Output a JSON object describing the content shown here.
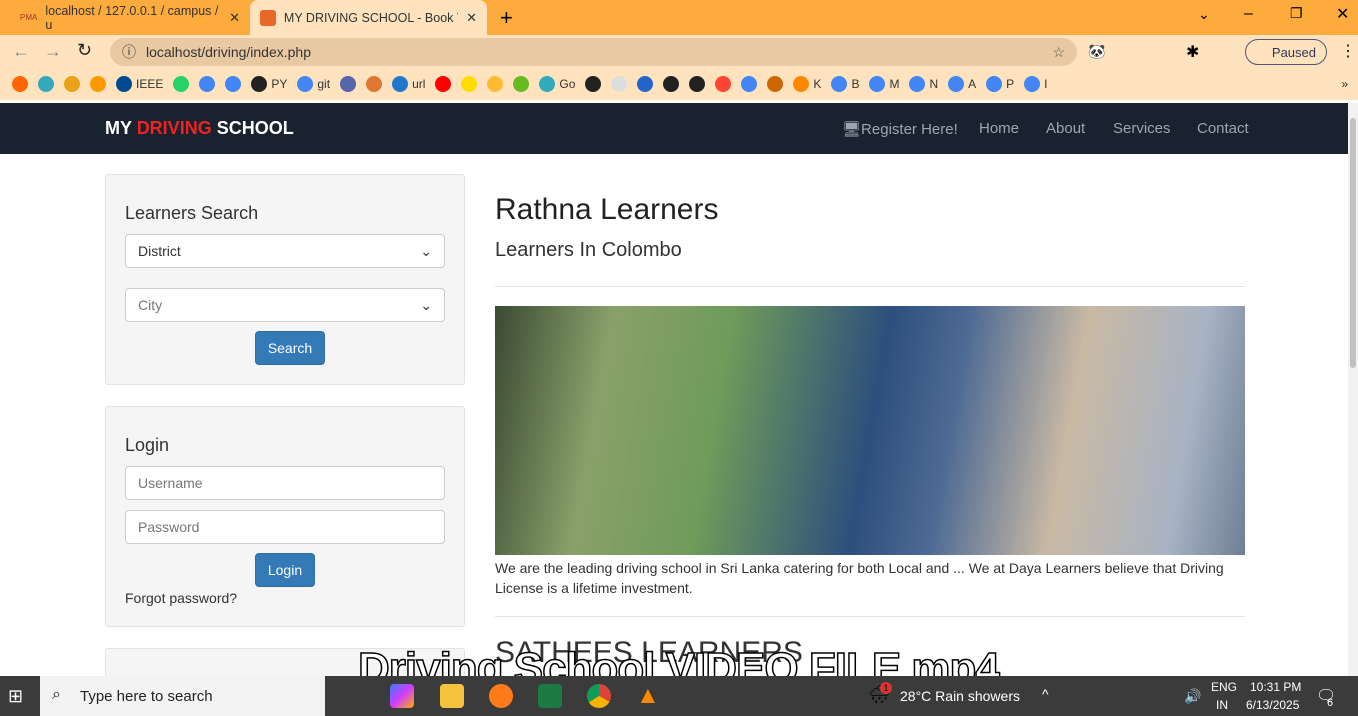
{
  "browser": {
    "tabs": [
      {
        "title": "localhost / 127.0.0.1 / campus / u",
        "icon": "phpmyadmin-icon"
      },
      {
        "title": "MY DRIVING SCHOOL - Book You",
        "icon": "xampp-icon",
        "active": true
      }
    ],
    "url": "localhost/driving/index.php",
    "profile_label": "Paused",
    "bookmarks": [
      "",
      "",
      "",
      "",
      "IEEE",
      "",
      "",
      "",
      "PY",
      "git",
      "",
      "",
      "url",
      "",
      "",
      "",
      "",
      "Go",
      "",
      "",
      "",
      "",
      "",
      "",
      "",
      "",
      "K",
      "B",
      "M",
      "N",
      "A",
      "P",
      "I"
    ]
  },
  "site": {
    "brand": {
      "part1": "MY ",
      "part2": "DRIVING",
      "part3": " SCHOOL"
    },
    "nav": [
      "Register Here!",
      "Home",
      "About",
      "Services",
      "Contact"
    ],
    "search": {
      "title": "Learners Search",
      "district": "District",
      "city": "City",
      "button": "Search"
    },
    "login": {
      "title": "Login",
      "username_placeholder": "Username",
      "password_placeholder": "Password",
      "button": "Login",
      "forgot": "Forgot password?"
    },
    "main": {
      "title": "Rathna Learners",
      "subtitle": "Learners In Colombo",
      "description": "We are the leading driving school in Sri Lanka catering for both Local and ... We at Daya Learners believe that Driving License is a lifetime investment.",
      "next_title": "SATHEES LEARNERS"
    }
  },
  "video_subtitle": "Driving School VIDEO FILE mp4",
  "taskbar": {
    "search_placeholder": "Type here to search",
    "weather": "28°C  Rain showers",
    "weather_badge": "1",
    "lang": "ENG",
    "region": "IN",
    "time": "10:31 PM",
    "date": "6/13/2025",
    "notifications": "6"
  },
  "colors": {
    "chrome": "#fdab3c",
    "navbar": "#18232f",
    "brand_red": "#e22222",
    "button": "#337ab7"
  }
}
